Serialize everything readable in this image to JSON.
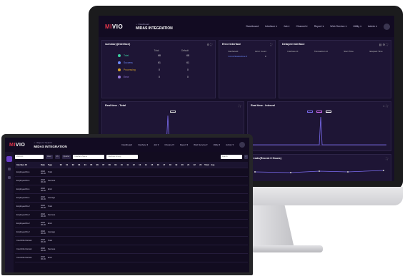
{
  "desktop": {
    "logo": {
      "prefix": "MI",
      "suffix": "VIO"
    },
    "breadcrumb": "⌂ / Dashboard",
    "title": "MIDAS INTEGRATION",
    "nav": [
      "Dashboard",
      "Interface ▾",
      "Job ▾",
      "Channel ▾",
      "Report ▾",
      "Web Service ▾",
      "Utility ▾",
      "Admin ▾"
    ],
    "summary": {
      "title": "summary(Interface)",
      "columns": [
        "Total",
        "Default"
      ],
      "rows": [
        {
          "label": "Total",
          "color": "#3ad0a0",
          "total": "68",
          "default": "68"
        },
        {
          "label": "Success",
          "color": "#6e8bff",
          "total": "61",
          "default": "61"
        },
        {
          "label": "Processing",
          "color": "#d4a12a",
          "total": "0",
          "default": "0"
        },
        {
          "label": "Error",
          "color": "#9a7be0",
          "total": "0",
          "default": "0"
        }
      ]
    },
    "error_interface": {
      "title": "Error Interface",
      "columns": [
        "InterfaceId",
        "Error Count"
      ],
      "row": {
        "id": "CommStatusZone #",
        "count": "3"
      }
    },
    "delayed_interface": {
      "title": "Delayed Interface",
      "columns": [
        "Interface Id",
        "Transaction Id",
        "Start Time",
        "Elapsed Time"
      ]
    },
    "realtime_total": {
      "title": "Real time - Total"
    },
    "realtime_interval": {
      "title": "Real time - Interval"
    },
    "trends": {
      "title": "Trends(Recent 6 Hours)"
    }
  },
  "laptop": {
    "breadcrumb": "⌂ / Report / Search",
    "title": "MIDAS INTEGRATION",
    "nav": [
      "Dashboard",
      "Interface ▾",
      "Job ▾",
      "Channel ▾",
      "Report ▾",
      "Web Service ▾",
      "Utility ▾",
      "Admin ▾"
    ],
    "filters": {
      "start": "2020-01",
      "unit": "Hour",
      "range": "1h",
      "mode": "Quarter",
      "interface_placeholder": "Interface Name",
      "group_placeholder": "Interface Group",
      "search_placeholder": "Search"
    },
    "table": {
      "columns": [
        "Interface ID",
        "Date",
        "Type",
        "00",
        "01",
        "02",
        "03",
        "04",
        "05",
        "06",
        "07",
        "08",
        "09",
        "10",
        "11",
        "12",
        "13",
        "14",
        "15",
        "16",
        "17",
        "18",
        "19",
        "20",
        "21",
        "22",
        "23",
        "Total",
        "Avg"
      ],
      "rows": [
        {
          "id": "EmployeeInfo.1",
          "date": "2020 06-30",
          "type": "Total"
        },
        {
          "id": "EmployeeInfo.1",
          "date": "2020 06-30",
          "type": "Success"
        },
        {
          "id": "EmployeeInfo.1",
          "date": "2020 06-30",
          "type": "Error"
        },
        {
          "id": "EmployeeInfo.1",
          "date": "2020 06-30",
          "type": "Average"
        },
        {
          "id": "EmployeeInfo.2",
          "date": "2020 06-30",
          "type": "Total"
        },
        {
          "id": "EmployeeInfo.2",
          "date": "2020 06-30",
          "type": "Success"
        },
        {
          "id": "EmployeeInfo.2",
          "date": "2020 06-30",
          "type": "Error"
        },
        {
          "id": "EmployeeInfo.2",
          "date": "2020 06-30",
          "type": "Average"
        },
        {
          "id": "CountInfo.Interval",
          "date": "2020 06-30",
          "type": "Total"
        },
        {
          "id": "CountInfo.Interval",
          "date": "2020 06-30",
          "type": "Success"
        },
        {
          "id": "CountInfo.Interval",
          "date": "2020 06-30",
          "type": "Error"
        }
      ]
    }
  }
}
